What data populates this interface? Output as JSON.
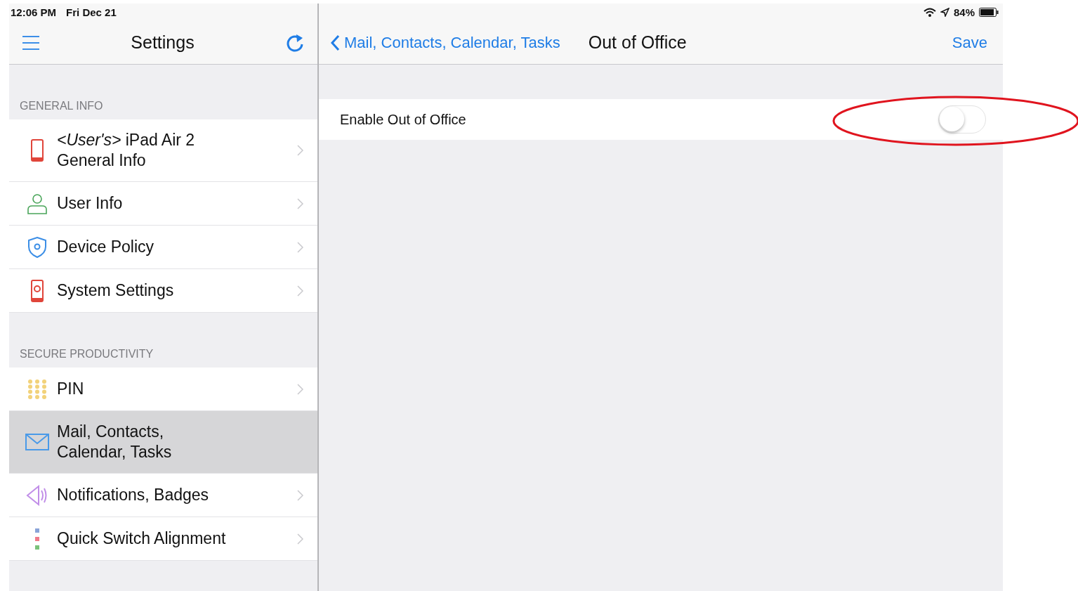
{
  "status_bar": {
    "time": "12:06 PM",
    "date": "Fri Dec 21",
    "battery": "84%"
  },
  "sidebar": {
    "title": "Settings",
    "sections": [
      {
        "header": "GENERAL INFO",
        "items": [
          {
            "kind": "phone",
            "lines": [
              "*<User's>*  iPad Air 2",
              "General Info"
            ],
            "selected": false
          },
          {
            "kind": "user",
            "lines": [
              "User Info"
            ],
            "selected": false
          },
          {
            "kind": "shield",
            "lines": [
              "Device Policy"
            ],
            "selected": false
          },
          {
            "kind": "settings",
            "lines": [
              "System Settings"
            ],
            "selected": false
          }
        ]
      },
      {
        "header": "SECURE PRODUCTIVITY",
        "items": [
          {
            "kind": "keypad",
            "lines": [
              "PIN"
            ],
            "selected": false
          },
          {
            "kind": "mail",
            "lines": [
              "Mail, Contacts,",
              "Calendar, Tasks"
            ],
            "selected": true
          },
          {
            "kind": "speaker",
            "lines": [
              "Notifications, Badges"
            ],
            "selected": false
          },
          {
            "kind": "dots",
            "lines": [
              "Quick Switch Alignment"
            ],
            "selected": false
          }
        ]
      }
    ]
  },
  "detail": {
    "back": "Mail, Contacts, Calendar, Tasks",
    "title": "Out of Office",
    "action": "Save",
    "rows": [
      {
        "label": "Enable Out of Office",
        "on": false
      }
    ]
  }
}
